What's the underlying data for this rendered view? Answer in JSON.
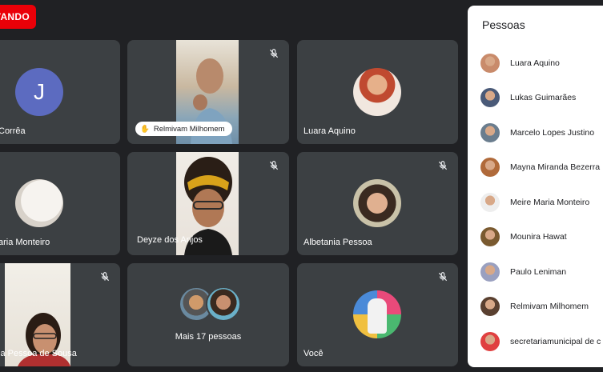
{
  "recording": {
    "label": "VANDO"
  },
  "tiles": {
    "t1": {
      "name": "Corrêa",
      "initial": "J"
    },
    "t2": {
      "hand_label": "Relmivam Milhomem"
    },
    "t3": {
      "name": "Luara Aquino"
    },
    "t4": {
      "name": "aria Monteiro"
    },
    "t5": {
      "name": "Deyze dos Anjos"
    },
    "t6": {
      "name": "Albetania Pessoa"
    },
    "t7": {
      "name": "ia Pessoa de Sousa"
    },
    "t8": {
      "label": "Mais 17 pessoas"
    },
    "t9": {
      "name": "Você"
    }
  },
  "people_panel": {
    "title": "Pessoas",
    "people": [
      {
        "name": "Luara Aquino",
        "color": "#c98b6b"
      },
      {
        "name": "Lukas Guimarães",
        "color": "#4a5a78"
      },
      {
        "name": "Marcelo Lopes Justino",
        "color": "#6a7d8e"
      },
      {
        "name": "Mayna Miranda Bezerra",
        "color": "#b06a3a"
      },
      {
        "name": "Meire Maria Monteiro",
        "color": "#eeeeee"
      },
      {
        "name": "Mounira Hawat",
        "color": "#7a5a30"
      },
      {
        "name": "Paulo Leniman",
        "color": "#9aa0c0"
      },
      {
        "name": "Relmivam Milhomem",
        "color": "#5a4030"
      },
      {
        "name": "secretariamunicipal de c",
        "color": "#e04040"
      }
    ]
  }
}
